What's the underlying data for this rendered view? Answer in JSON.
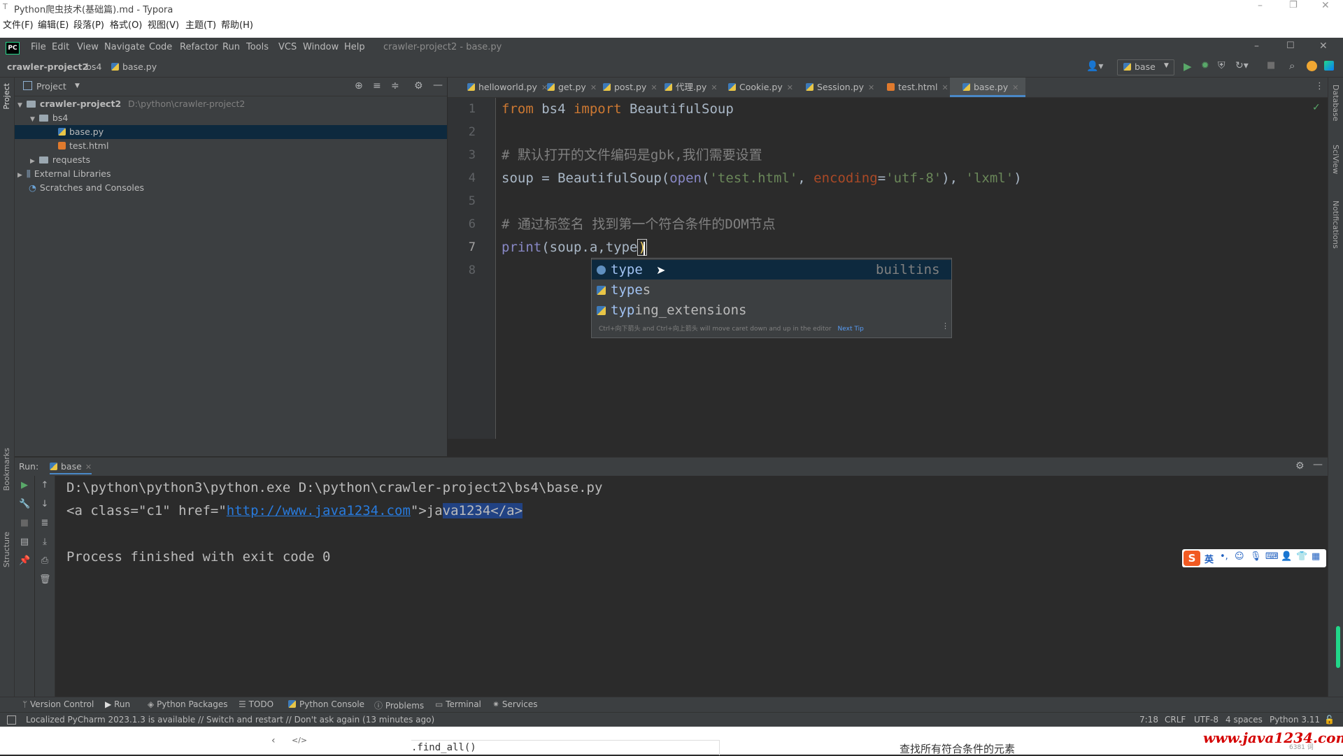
{
  "typora": {
    "title": "Python爬虫技术(基础篇).md - Typora",
    "menu": [
      "文件(F)",
      "编辑(E)",
      "段落(P)",
      "格式(O)",
      "视图(V)",
      "主题(T)",
      "帮助(H)"
    ],
    "bottom_left": ".find_all()",
    "bottom_right": "查找所有符合条件的元素",
    "watermark": "www.java1234.com",
    "word_count": "6381 词"
  },
  "menubar": {
    "items": [
      "File",
      "Edit",
      "View",
      "Navigate",
      "Code",
      "Refactor",
      "Run",
      "Tools",
      "VCS",
      "Window",
      "Help"
    ],
    "window_title": "crawler-project2 - base.py"
  },
  "navbar": {
    "breadcrumb": [
      "crawler-project2",
      "bs4",
      "base.py"
    ],
    "run_config": "base"
  },
  "project_panel": {
    "title": "Project",
    "root_name": "crawler-project2",
    "root_path": "D:\\python\\crawler-project2",
    "items": [
      "bs4",
      "base.py",
      "test.html",
      "requests",
      "External Libraries",
      "Scratches and Consoles"
    ],
    "side_label": "Project"
  },
  "editor_tabs": [
    "helloworld.py",
    "get.py",
    "post.py",
    "代理.py",
    "Cookie.py",
    "Session.py",
    "test.html",
    "base.py"
  ],
  "active_tab": "base.py",
  "code": {
    "line_numbers": [
      "1",
      "2",
      "3",
      "4",
      "5",
      "6",
      "7",
      "8"
    ],
    "l1_from": "from",
    "l1_mod": " bs4 ",
    "l1_import": "import",
    "l1_name": " BeautifulSoup",
    "l3": "# 默认打开的文件编码是gbk,我们需要设置",
    "l4_a": "soup = BeautifulSoup(",
    "l4_open": "open",
    "l4_b": "(",
    "l4_s1": "'test.html'",
    "l4_c": ", ",
    "l4_enc": "encoding",
    "l4_d": "=",
    "l4_s2": "'utf-8'",
    "l4_e": "), ",
    "l4_s3": "'lxml'",
    "l4_f": ")",
    "l6": "# 通过标签名 找到第一个符合条件的DOM节点",
    "l7_print": "print",
    "l7_a": "(soup.a,type",
    "l7_b": ")"
  },
  "autocomplete": {
    "items": [
      {
        "match": "type",
        "rest": "",
        "source": "builtins"
      },
      {
        "match": "type",
        "rest": "s",
        "source": ""
      },
      {
        "match": "typ",
        "rest": "ing_extensions",
        "source": ""
      }
    ],
    "tip": "Ctrl+向下箭头 and Ctrl+向上箭头 will move caret down and up in the editor",
    "next_tip": "Next Tip"
  },
  "run": {
    "label": "Run:",
    "tab": "base",
    "cmd": "D:\\python\\python3\\python.exe D:\\python\\crawler-project2\\bs4\\base.py",
    "out_a": "<a class=\"c1\" href=\"",
    "out_link": "http://www.java1234.com",
    "out_b": "\">ja",
    "out_sel": "va1234</a>",
    "exit": "Process finished with exit code 0"
  },
  "tool_tabs": [
    "Version Control",
    "Run",
    "Python Packages",
    "TODO",
    "Python Console",
    "Problems",
    "Terminal",
    "Services"
  ],
  "side_labels": {
    "bookmarks": "Bookmarks",
    "structure": "Structure",
    "database": "Database",
    "sciview": "SciView",
    "notifications": "Notifications"
  },
  "status": {
    "message": "Localized PyCharm 2023.1.3 is available // Switch and restart // Don't ask again (13 minutes ago)",
    "position": "7:18",
    "line_sep": "CRLF",
    "encoding": "UTF-8",
    "indent": "4 spaces",
    "interpreter": "Python 3.11"
  },
  "ime": {
    "lang": "英"
  },
  "colors": {
    "accent": "#4a88c7",
    "selection": "#214283",
    "link": "#287bde"
  }
}
